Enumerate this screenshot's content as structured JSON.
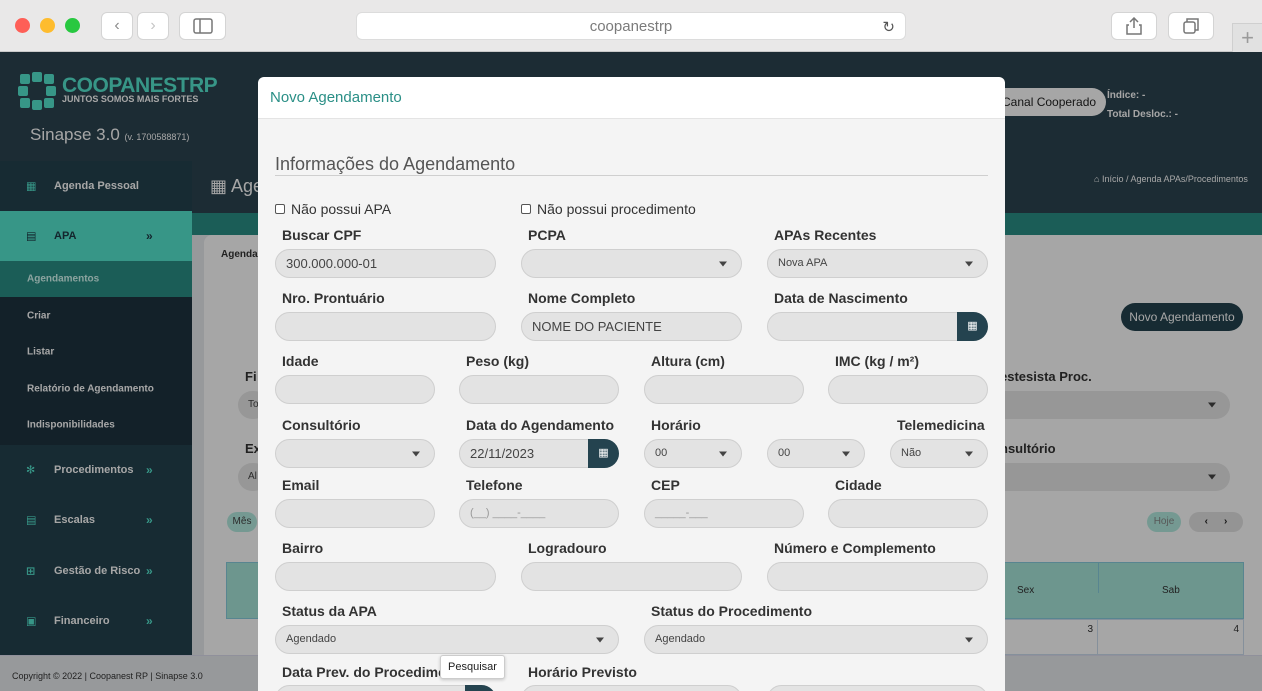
{
  "browser": {
    "url": "coopanestrp",
    "reload_icon": "reload-icon",
    "share_icon": "share-icon",
    "tabs_icon": "tabs-icon",
    "newtab_icon": "plus-icon"
  },
  "header": {
    "brand": "COOPANESTRP",
    "tagline": "JUNTOS SOMOS MAIS FORTES",
    "app_name": "Sinapse 3.0",
    "version": "(v. 1700588871)",
    "canal_button": "Canal Cooperado",
    "indice_label": "Índice: -",
    "deslocamento_label": "Total Desloc.: -"
  },
  "sidebar": {
    "items": [
      {
        "label": "Agenda Pessoal",
        "icon": "calendar-grid-icon"
      },
      {
        "label": "APA",
        "icon": "calendar-icon",
        "chevron": "»"
      },
      {
        "label": "Procedimentos",
        "icon": "stethoscope-icon",
        "chevron": "»"
      },
      {
        "label": "Escalas",
        "icon": "calendar-icon",
        "chevron": "»"
      },
      {
        "label": "Gestão de Risco",
        "icon": "plus-square-icon",
        "chevron": "»"
      },
      {
        "label": "Financeiro",
        "icon": "money-icon",
        "chevron": "»"
      }
    ],
    "submenu": [
      "Agendamentos",
      "Criar",
      "Listar",
      "Relatório de Agendamento",
      "Indisponibilidades"
    ]
  },
  "page": {
    "heading_fragment": "Age",
    "breadcrumb": "Início / Agenda APAs/Procedimentos",
    "tab_fragment": "Agenda",
    "novo_button": "Novo Agendamento",
    "filter_fragment": "Fi",
    "filter_value_fragment": "To",
    "ex_fragment": "Ex",
    "ex_value_fragment": "Al",
    "anestesista_label": "estesista Proc.",
    "consultorio_label": "nsultório",
    "mes_button": "Mês",
    "hoje_button": "Hoje",
    "prev_icon": "chevron-left-icon",
    "next_icon": "chevron-right-icon",
    "calendar": {
      "days": [
        "Sex",
        "Sab"
      ],
      "dates": [
        "3",
        "4"
      ]
    },
    "footer": "Copyright © 2022 | Coopanest RP | Sinapse 3.0"
  },
  "modal": {
    "title": "Novo Agendamento",
    "section_title": "Informações do Agendamento",
    "nao_possui_apa": "Não possui APA",
    "nao_possui_procedimento": "Não possui procedimento",
    "fields": {
      "buscar_cpf": {
        "label": "Buscar CPF",
        "value": "300.000.000-01"
      },
      "pcpa": {
        "label": "PCPA",
        "value": ""
      },
      "apas_recentes": {
        "label": "APAs Recentes",
        "value": "Nova APA"
      },
      "nro_prontuario": {
        "label": "Nro. Prontuário",
        "value": ""
      },
      "nome_completo": {
        "label": "Nome Completo",
        "value": "NOME DO PACIENTE"
      },
      "data_nascimento": {
        "label": "Data de Nascimento",
        "value": ""
      },
      "idade": {
        "label": "Idade",
        "value": ""
      },
      "peso": {
        "label": "Peso (kg)",
        "value": ""
      },
      "altura": {
        "label": "Altura (cm)",
        "value": ""
      },
      "imc": {
        "label": "IMC (kg / m²)",
        "value": ""
      },
      "consultorio": {
        "label": "Consultório",
        "value": ""
      },
      "data_agendamento": {
        "label": "Data do Agendamento",
        "value": "22/11/2023"
      },
      "horario": {
        "label": "Horário",
        "hour": "00",
        "minute": "00"
      },
      "telemedicina": {
        "label": "Telemedicina",
        "value": "Não"
      },
      "email": {
        "label": "Email",
        "value": ""
      },
      "telefone": {
        "label": "Telefone",
        "placeholder": "(__) ____-____"
      },
      "cep": {
        "label": "CEP",
        "placeholder": "_____-___"
      },
      "cidade": {
        "label": "Cidade",
        "value": ""
      },
      "bairro": {
        "label": "Bairro",
        "value": ""
      },
      "logradouro": {
        "label": "Logradouro",
        "value": ""
      },
      "numero": {
        "label": "Número e Complemento",
        "value": ""
      },
      "status_apa": {
        "label": "Status da APA",
        "value": "Agendado"
      },
      "status_procedimento": {
        "label": "Status do Procedimento",
        "value": "Agendado"
      },
      "data_prev": {
        "label": "Data Prev. do Procediment"
      },
      "horario_previsto": {
        "label": "Horário Previsto"
      }
    },
    "tooltip": "Pesquisar"
  }
}
